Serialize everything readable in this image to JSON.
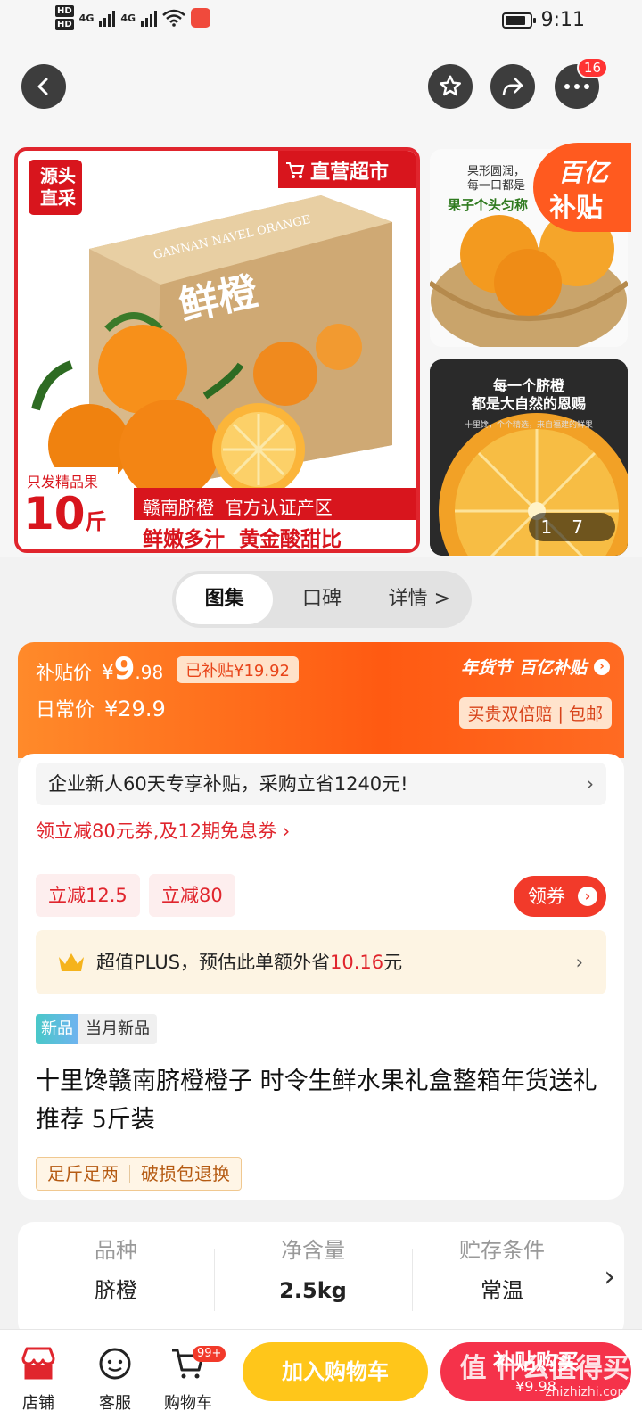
{
  "status_bar": {
    "hd1": "HD",
    "hd2": "HD",
    "net1": "4G",
    "net2": "4G",
    "time": "9:11"
  },
  "nav": {
    "more_badge": "16"
  },
  "gallery": {
    "main_image": {
      "corner_tag": "源头直采",
      "store_tag": "直营超市",
      "box_brand": "GANNAN NAVEL ORANGE",
      "box_title": "鲜橙",
      "weight_label": "只发精品果",
      "weight_value": "10",
      "weight_unit": "斤",
      "banner_line1": "赣南脐橙  官方认证产区",
      "banner_line2": "鲜嫩多汁  黄金酸甜比"
    },
    "side_image_1": {
      "caption1": "果形圆润，",
      "caption2": "每一口都是",
      "caption3": "果子个头匀称"
    },
    "side_image_2": {
      "caption1": "每一个脐橙",
      "caption2": "都是大自然的恩赐",
      "caption3": "十里馋，个个精选，来自福建的鲜果"
    },
    "counter_current": "1",
    "counter_total": "7",
    "subsidy_badge_line1": "百亿",
    "subsidy_badge_line2": "补贴"
  },
  "tabs": [
    "图集",
    "口碑",
    "详情 >"
  ],
  "price": {
    "subsidy_label": "补贴价",
    "currency": "¥",
    "subsidy_int": "9",
    "subsidy_dec": ".98",
    "saved_tag": "已补贴¥19.92",
    "daily_label": "日常价",
    "daily_price": "¥29.9",
    "festival": "年货节",
    "program": "百亿补贴",
    "promo": "买贵双倍赔 | 包邮"
  },
  "offers": {
    "enterprise": "企业新人60天专享补贴，采购立省1240元!",
    "coupon_line": "领立减80元券,及12期免息券 ›",
    "chip1": "立减12.5",
    "chip2": "立减80",
    "coupon_button": "领券",
    "plus_prefix": "超值PLUS，预估此单额外省",
    "plus_amount": "10.16",
    "plus_suffix": "元"
  },
  "product": {
    "new_tag": "新品",
    "new_desc": "当月新品",
    "title": "十里馋赣南脐橙橙子 时令生鲜水果礼盒整箱年货送礼推荐 5斤装",
    "guarantee1": "足斤足两",
    "guarantee2": "破损包退换"
  },
  "specs": [
    {
      "key": "品种",
      "value": "脐橙"
    },
    {
      "key": "净含量",
      "value": "2.5kg"
    },
    {
      "key": "贮存条件",
      "value": "常温"
    }
  ],
  "bottom": {
    "store": "店铺",
    "service": "客服",
    "cart": "购物车",
    "cart_badge": "99+",
    "add_cart": "加入购物车",
    "buy_line1": "补贴购买",
    "buy_line2": "¥9.98"
  },
  "watermark": "值 什么值得买",
  "watermark_url": "zhizhizhi.com",
  "colors": {
    "accent_red": "#e0252d",
    "orange": "#ff5a12",
    "yellow_button": "#ffc61a",
    "buy_button": "#f5324a"
  }
}
